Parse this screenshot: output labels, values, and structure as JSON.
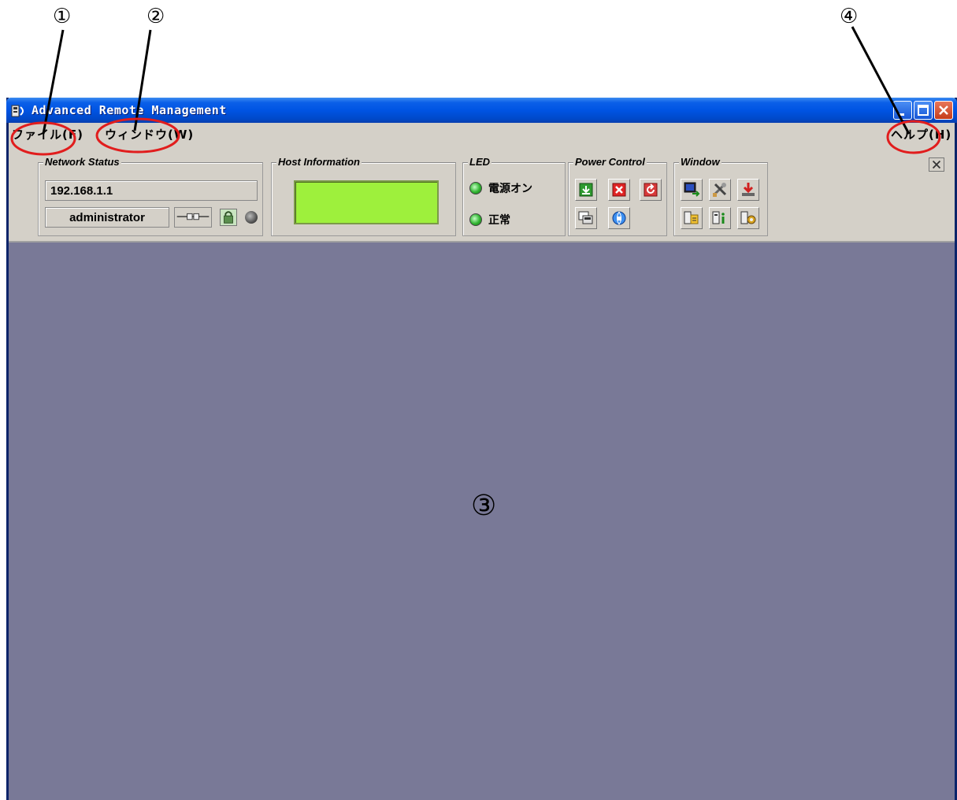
{
  "annotations": {
    "num1": "①",
    "num2": "②",
    "num3": "③",
    "num4": "④"
  },
  "window": {
    "title": "Advanced Remote Management"
  },
  "menu": {
    "file": "ファイル(F)",
    "window": "ウィンドウ(W)",
    "help": "ヘルプ(H)"
  },
  "network_status": {
    "title": "Network Status",
    "ip": "192.168.1.1",
    "user": "administrator"
  },
  "host_information": {
    "title": "Host Information"
  },
  "led": {
    "title": "LED",
    "power_label": "電源オン",
    "status_label": "正常",
    "led_color": "#2fb32f"
  },
  "power_control": {
    "title": "Power Control",
    "buttons": [
      "power-on-icon",
      "power-off-icon",
      "reset-icon",
      "console-icon",
      "globe-icon"
    ]
  },
  "window_group": {
    "title": "Window",
    "buttons": [
      "monitor-arrow-icon",
      "tools-icon",
      "download-icon",
      "document-icon",
      "info-icon",
      "settings-icon"
    ]
  },
  "colors": {
    "titlebar": "#0054e3",
    "main_area": "#797997",
    "lcd": "#9ef03c",
    "callout_circle": "#e11d1d"
  }
}
